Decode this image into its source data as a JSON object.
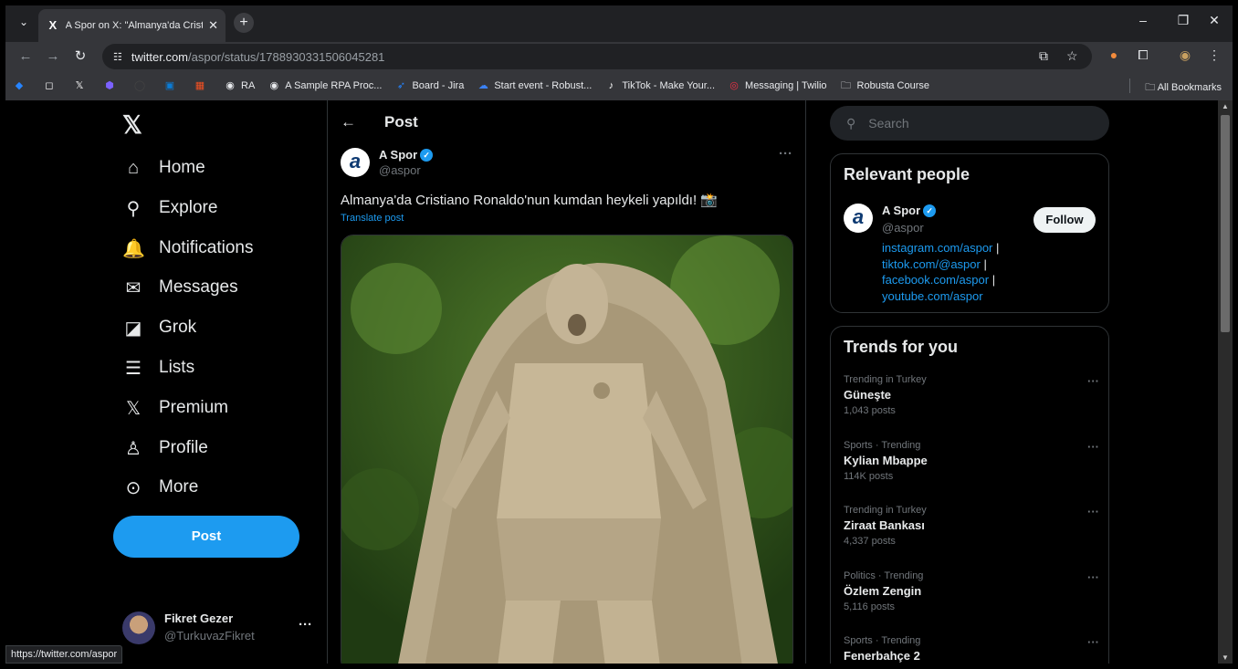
{
  "browser": {
    "tab_title": "A Spor on X: \"Almanya'da Cristi",
    "tab_favicon": "X",
    "url_host": "twitter.com",
    "url_path": "/aspor/status/1788930331506045281",
    "status_url": "https://twitter.com/aspor"
  },
  "bookmarks": [
    {
      "label": "",
      "icon": "jira-diamond-icon",
      "glyph": "◆",
      "color": "#2684ff"
    },
    {
      "label": "",
      "icon": "square-icon",
      "glyph": "◻",
      "color": "#ffffff"
    },
    {
      "label": "",
      "icon": "x-icon",
      "glyph": "𝕏",
      "color": "#ffffff"
    },
    {
      "label": "",
      "icon": "hexagon-icon",
      "glyph": "⬢",
      "color": "#7b61ff"
    },
    {
      "label": "",
      "icon": "github-icon",
      "glyph": "◯",
      "color": "#444444"
    },
    {
      "label": "",
      "icon": "outlook-icon",
      "glyph": "▣",
      "color": "#0a7cd6"
    },
    {
      "label": "",
      "icon": "microsoft-icon",
      "glyph": "▦",
      "color": "#f25022"
    },
    {
      "label": "RA",
      "icon": "globe-icon",
      "glyph": "◉",
      "color": "#e8eaed"
    },
    {
      "label": "A Sample RPA Proc...",
      "icon": "globe-icon",
      "glyph": "◉",
      "color": "#e8eaed"
    },
    {
      "label": "Board - Jira",
      "icon": "jira-icon",
      "glyph": "➶",
      "color": "#2684ff"
    },
    {
      "label": "Start event - Robust...",
      "icon": "robusta-icon",
      "glyph": "☁",
      "color": "#3b82f6"
    },
    {
      "label": "TikTok - Make Your...",
      "icon": "tiktok-icon",
      "glyph": "♪",
      "color": "#ffffff"
    },
    {
      "label": "Messaging | Twilio",
      "icon": "twilio-icon",
      "glyph": "◎",
      "color": "#f22f46"
    },
    {
      "label": "Robusta Course",
      "icon": "folder-icon",
      "glyph": "🗀",
      "color": "#e8eaed"
    }
  ],
  "all_bookmarks_label": "All Bookmarks",
  "nav": {
    "items": [
      {
        "label": "Home",
        "icon": "home-icon",
        "glyph": "⌂"
      },
      {
        "label": "Explore",
        "icon": "search-icon",
        "glyph": "⚲"
      },
      {
        "label": "Notifications",
        "icon": "bell-icon",
        "glyph": "🔔"
      },
      {
        "label": "Messages",
        "icon": "envelope-icon",
        "glyph": "✉"
      },
      {
        "label": "Grok",
        "icon": "grok-icon",
        "glyph": "◪"
      },
      {
        "label": "Lists",
        "icon": "list-icon",
        "glyph": "☰"
      },
      {
        "label": "Premium",
        "icon": "x-logo-icon",
        "glyph": "𝕏"
      },
      {
        "label": "Profile",
        "icon": "person-icon",
        "glyph": "♙"
      },
      {
        "label": "More",
        "icon": "more-circle-icon",
        "glyph": "⊙"
      }
    ],
    "post_label": "Post"
  },
  "account": {
    "name": "Fikret Gezer",
    "handle": "@TurkuvazFikret"
  },
  "main": {
    "header_title": "Post",
    "author_name": "A Spor",
    "author_handle": "@aspor",
    "avatar_letter": "a",
    "text": "Almanya'da Cristiano Ronaldo'nun kumdan heykeli yapıldı! 📸",
    "translate_label": "Translate post"
  },
  "sidebar": {
    "search_placeholder": "Search",
    "relevant_title": "Relevant people",
    "rp_name": "A Spor",
    "rp_handle": "@aspor",
    "follow_label": "Follow",
    "rp_links": [
      "instagram.com/aspor",
      "tiktok.com/@aspor",
      "facebook.com/aspor",
      "youtube.com/aspor"
    ],
    "trends_title": "Trends for you",
    "trends": [
      {
        "context": "Trending in Turkey",
        "name": "Güneşte",
        "count": "1,043 posts"
      },
      {
        "context": "Sports · Trending",
        "name": "Kylian Mbappe",
        "count": "114K posts"
      },
      {
        "context": "Trending in Turkey",
        "name": "Ziraat Bankası",
        "count": "4,337 posts"
      },
      {
        "context": "Politics · Trending",
        "name": "Özlem Zengin",
        "count": "5,116 posts"
      },
      {
        "context": "Sports · Trending",
        "name": "Fenerbahçe 2",
        "count": ""
      }
    ]
  },
  "colors": {
    "accent": "#1d9bf0",
    "background": "#000000",
    "border": "#2f3336"
  }
}
